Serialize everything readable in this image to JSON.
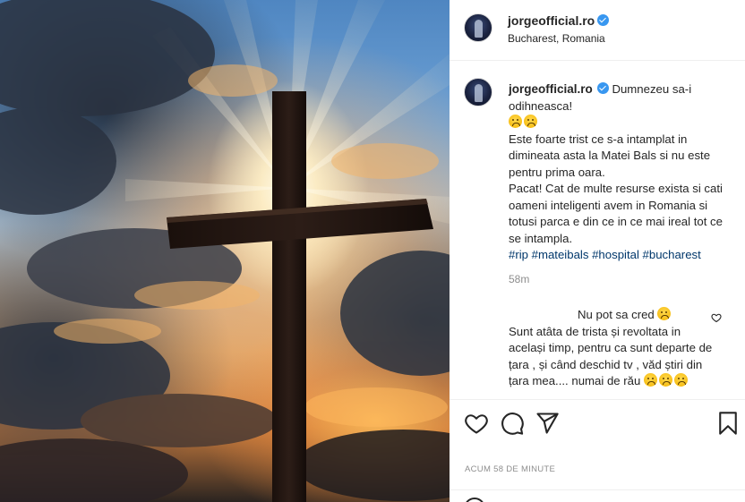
{
  "post": {
    "username": "jorgeofficial.ro",
    "location": "Bucharest, Romania"
  },
  "caption": {
    "username": "jorgeofficial.ro",
    "line1": "Dumnezeu sa-i odihneasca!",
    "line2": "Este foarte trist ce s-a intamplat in dimineata asta la Matei Bals si nu este pentru prima oara.",
    "line3": "Pacat! Cat de multe resurse exista si cati oameni inteligenti avem in Romania si totusi parca e din ce in ce mai ireal tot ce se intampla.",
    "tags": "#rip #mateibals #hospital #bucharest",
    "time_ago": "58m"
  },
  "comment2": {
    "first_line": "Nu pot sa cred",
    "body": "Sunt atâta de trista și revoltata in același timp, pentru ca sunt departe de țara , și când deschid tv , văd știri din țara mea.... numai de rău"
  },
  "actions": {
    "timestamp": "ACUM 58 DE MINUTE"
  },
  "icons": {
    "verified": "verified-badge-icon",
    "like": "heart-icon",
    "comment": "comment-icon",
    "share": "paper-plane-icon",
    "save": "bookmark-icon",
    "emoji_sad": "sad-face-emoji"
  },
  "colors": {
    "verified_blue": "#3897f0",
    "hashtag_blue": "#00376b",
    "muted_gray": "#8e8e8e",
    "text": "#262626"
  }
}
